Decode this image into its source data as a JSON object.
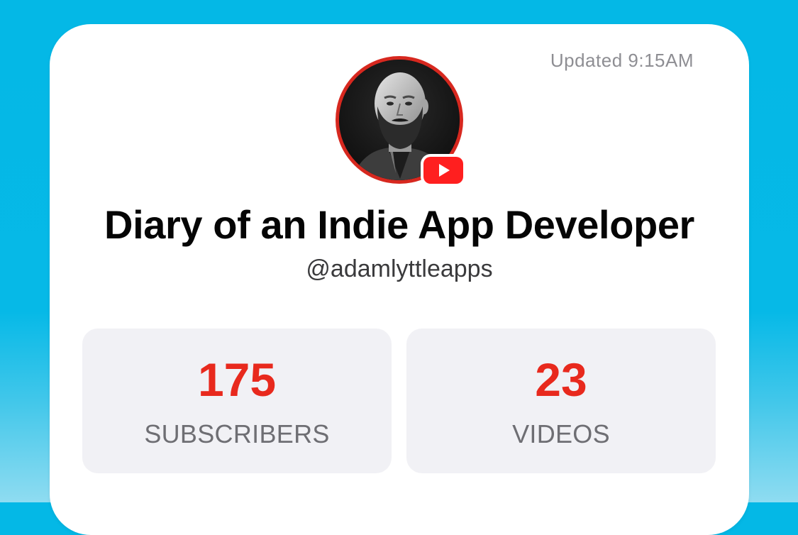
{
  "widget": {
    "updated_text": "Updated 9:15AM",
    "channel_name": "Diary of an Indie App Developer",
    "handle": "@adamlyttleapps",
    "avatar_icon": "profile-photo",
    "badge_icon": "youtube-play-icon",
    "stats": [
      {
        "value": "175",
        "label": "SUBSCRIBERS"
      },
      {
        "value": "23",
        "label": "VIDEOS"
      }
    ]
  },
  "colors": {
    "background": "#06b9e7",
    "card": "#ffffff",
    "accent_red": "#e8291d",
    "youtube_red": "#ff1f1f",
    "stat_tile": "#f1f1f5",
    "muted_text": "#8e8e93"
  }
}
